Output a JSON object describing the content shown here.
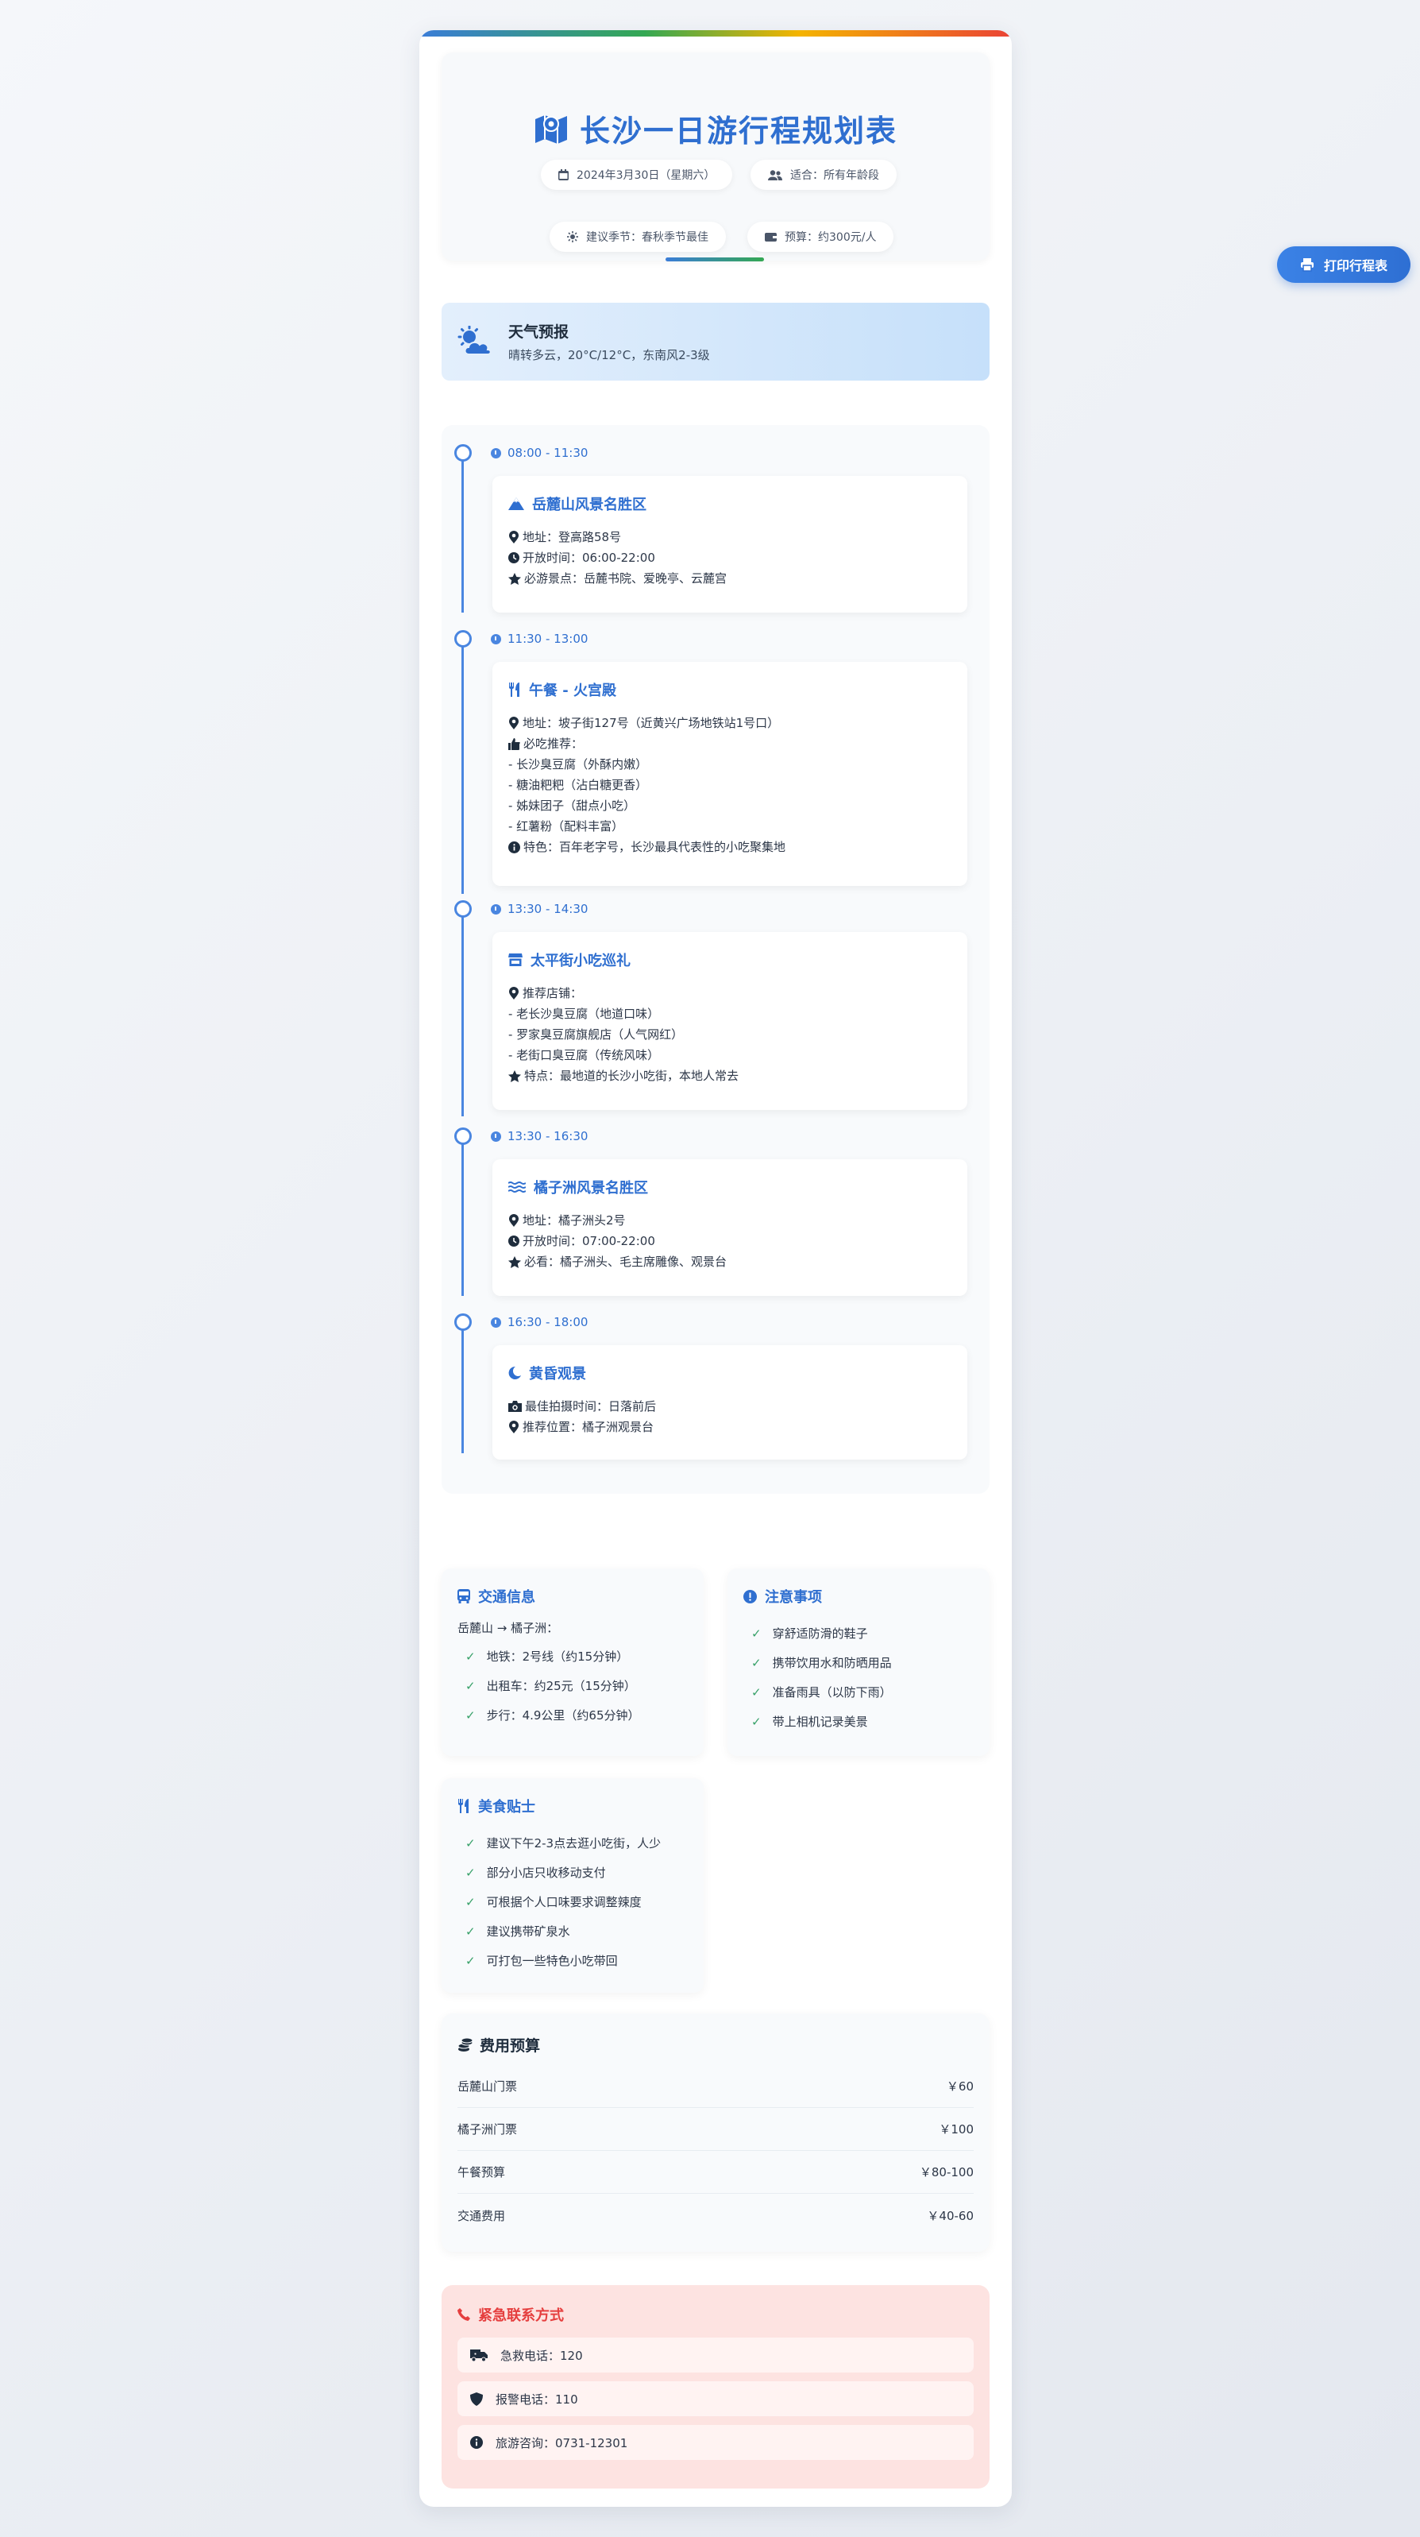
{
  "header": {
    "title": "长沙一日游行程规划表",
    "date": "2024年3月30日（星期六）",
    "audience": "适合：所有年龄段",
    "season": "建议季节：春秋季节最佳",
    "budget": "预算：约300元/人"
  },
  "print_button": "打印行程表",
  "weather": {
    "title": "天气预报",
    "desc": "晴转多云，20°C/12°C，东南风2-3级"
  },
  "timeline": [
    {
      "time": "08:00 - 11:30",
      "title": "岳麓山风景名胜区",
      "lines": [
        "地址：登高路58号",
        "开放时间：06:00-22:00",
        "必游景点：岳麓书院、爱晚亭、云麓宫"
      ]
    },
    {
      "time": "11:30 - 13:00",
      "title": "午餐 - 火宫殿",
      "lines": [
        "地址：坡子街127号（近黄兴广场地铁站1号口）",
        "必吃推荐：",
        "- 长沙臭豆腐（外酥内嫩）",
        "- 糖油粑粑（沾白糖更香）",
        "- 姊妹团子（甜点小吃）",
        "- 红薯粉（配料丰富）",
        "特色：百年老字号，长沙最具代表性的小吃聚集地"
      ]
    },
    {
      "time": "13:30 - 14:30",
      "title": "太平街小吃巡礼",
      "lines": [
        "推荐店铺：",
        "- 老长沙臭豆腐（地道口味）",
        "- 罗家臭豆腐旗舰店（人气网红）",
        "- 老街口臭豆腐（传统风味）",
        "特点：最地道的长沙小吃街，本地人常去"
      ]
    },
    {
      "time": "13:30 - 16:30",
      "title": "橘子洲风景名胜区",
      "lines": [
        "地址：橘子洲头2号",
        "开放时间：07:00-22:00",
        "必看：橘子洲头、毛主席雕像、观景台"
      ]
    },
    {
      "time": "16:30 - 18:00",
      "title": "黄昏观景",
      "lines": [
        "最佳拍摄时间：日落前后",
        "推荐位置：橘子洲观景台"
      ]
    }
  ],
  "transport": {
    "title": "交通信息",
    "route": "岳麓山 → 橘子洲：",
    "items": [
      "地铁：2号线（约15分钟）",
      "出租车：约25元（15分钟）",
      "步行：4.9公里（约65分钟）"
    ]
  },
  "notes": {
    "title": "注意事项",
    "items": [
      "穿舒适防滑的鞋子",
      "携带饮用水和防晒用品",
      "准备雨具（以防下雨）",
      "带上相机记录美景"
    ]
  },
  "food_tips": {
    "title": "美食贴士",
    "items": [
      "建议下午2-3点去逛小吃街，人少",
      "部分小店只收移动支付",
      "可根据个人口味要求调整辣度",
      "建议携带矿泉水",
      "可打包一些特色小吃带回"
    ]
  },
  "budget": {
    "title": "费用预算",
    "rows": [
      {
        "label": "岳麓山门票",
        "value": "￥60"
      },
      {
        "label": "橘子洲门票",
        "value": "￥100"
      },
      {
        "label": "午餐预算",
        "value": "￥80-100"
      },
      {
        "label": "交通费用",
        "value": "￥40-60"
      }
    ]
  },
  "emergency": {
    "title": "紧急联系方式",
    "items": [
      "急救电话：120",
      "报警电话：110",
      "旅游咨询：0731-12301"
    ]
  },
  "colors": {
    "accent": "#2f6fd0",
    "line": "#4a86e0",
    "check": "#38a169",
    "danger": "#e53e3e"
  }
}
